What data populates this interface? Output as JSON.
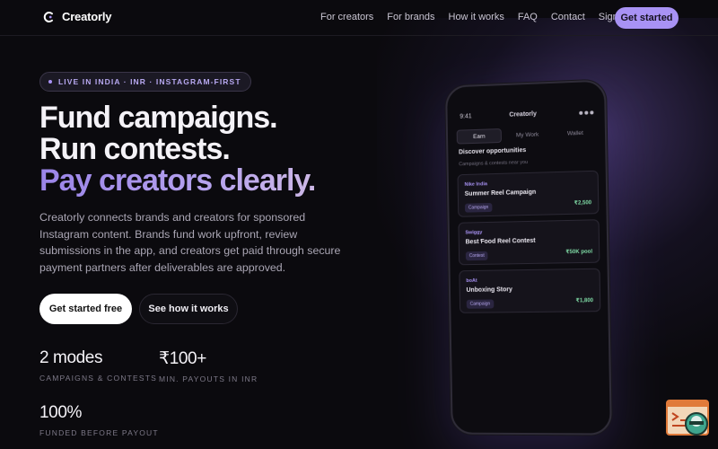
{
  "nav": {
    "brand": "Creatorly",
    "links": [
      "For creators",
      "For brands",
      "How it works",
      "FAQ",
      "Contact",
      "Sign in"
    ],
    "cta": "Get started"
  },
  "hero": {
    "pill": "LIVE IN INDIA · INR · INSTAGRAM-FIRST",
    "headline": [
      "Fund campaigns.",
      "Run contests.",
      "Pay creators clearly."
    ],
    "description": "Creatorly connects brands and creators for sponsored Instagram content. Brands fund work upfront, review submissions in the app, and creators get paid through secure payment partners after deliverables are approved.",
    "primary_button": "Get started free",
    "secondary_button": "See how it works"
  },
  "stats": [
    {
      "value": "2 modes",
      "label": "CAMPAIGNS & CONTESTS"
    },
    {
      "value": "₹100+",
      "label": "MIN. PAYOUTS IN INR"
    },
    {
      "value": "100%",
      "label": "FUNDED BEFORE PAYOUT"
    }
  ],
  "phone": {
    "time": "9:41",
    "title": "Creatorly",
    "tabs": [
      "Earn",
      "My Work",
      "Wallet"
    ],
    "heading": "Discover opportunities",
    "subheading": "Campaigns & contests near you",
    "cards": [
      {
        "brand": "Nike India",
        "title": "Summer Reel Campaign",
        "tag": "Campaign",
        "amount": "₹2,500"
      },
      {
        "brand": "Swiggy",
        "title": "Best Food Reel Contest",
        "tag": "Contest",
        "amount": "₹50K pool"
      },
      {
        "brand": "boAt",
        "title": "Unboxing Story",
        "tag": "Campaign",
        "amount": "₹1,800"
      }
    ]
  },
  "colors": {
    "background": "#0b0a0e",
    "accent": "#a892f4",
    "amount": "#7ed9a4"
  }
}
